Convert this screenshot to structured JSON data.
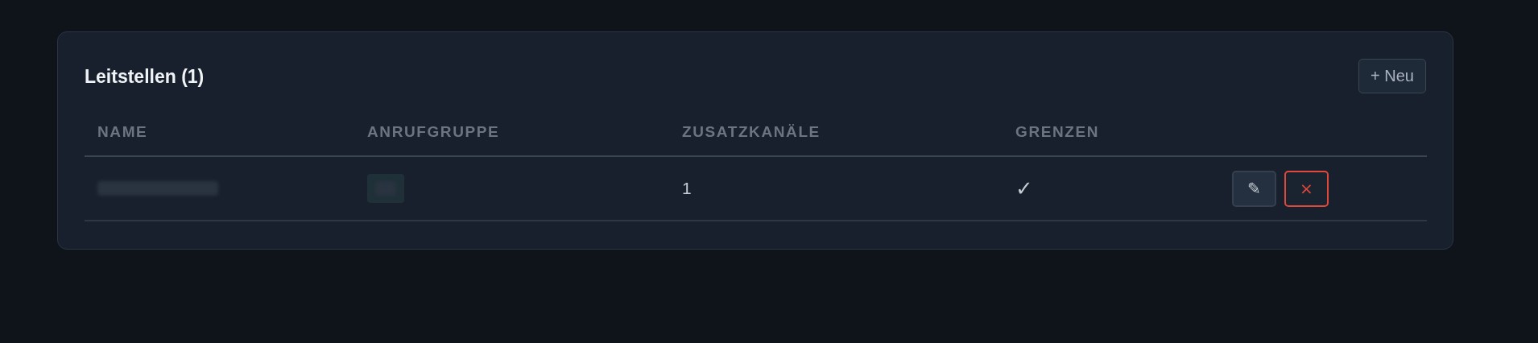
{
  "panel": {
    "title": "Leitstellen (1)",
    "new_button": "+ Neu"
  },
  "table": {
    "columns": [
      "NAME",
      "ANRUFGRUPPE",
      "ZUSATZKANÄLE",
      "GRENZEN"
    ],
    "rows": [
      {
        "name_redacted": true,
        "group_redacted": true,
        "extra_channels": "1",
        "limits": "✓",
        "edit": "✎",
        "delete": "×"
      }
    ]
  }
}
